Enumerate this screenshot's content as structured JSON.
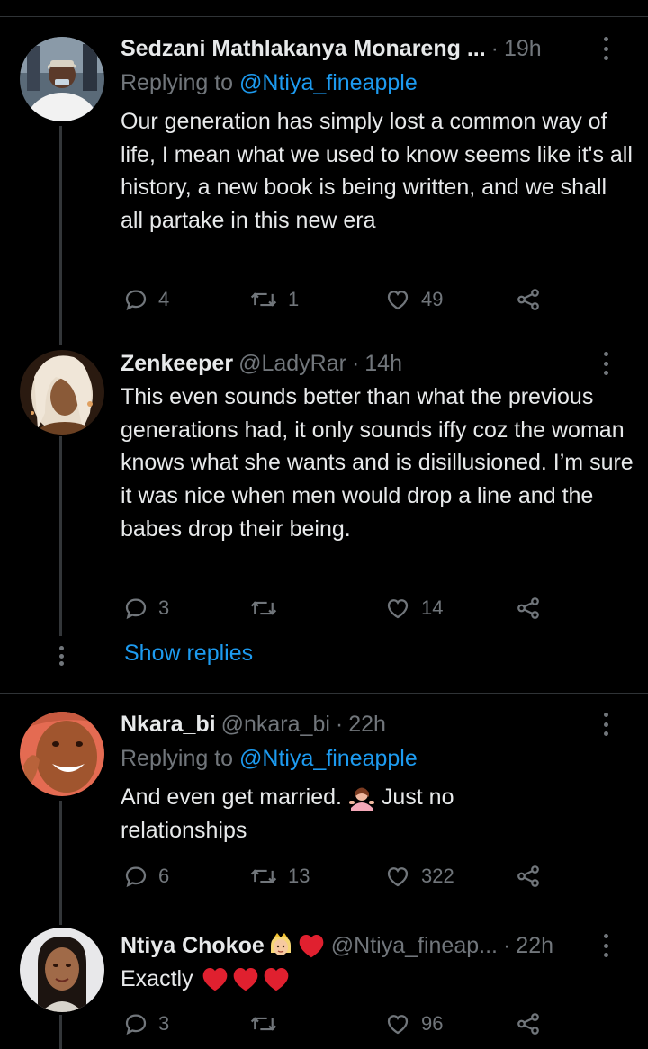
{
  "tweets": [
    {
      "name": "Sedzani Mathlakanya Monareng ...",
      "handle": "",
      "time": "19h",
      "reply_prefix": "Replying to",
      "reply_mention": "@Ntiya_fineapple",
      "text": "Our generation has simply lost a common way of life, I mean what we used to know seems like it's all history, a new book is being written, and we shall all partake in this new era",
      "replies": "4",
      "retweets": "1",
      "likes": "49"
    },
    {
      "name": "Zenkeeper",
      "handle": "@LadyRar",
      "time": "14h",
      "text": "This even sounds better than what the previous generations had, it only sounds iffy coz the woman knows what she wants and is disillusioned. I’m sure it was nice when men would drop a line and the babes drop their being.",
      "replies": "3",
      "retweets": "",
      "likes": "14"
    },
    {
      "name": "Nkara_bi",
      "handle": "@nkara_bi",
      "time": "22h",
      "reply_prefix": "Replying to",
      "reply_mention": "@Ntiya_fineapple",
      "text_a": "And even get married.",
      "text_b": "Just no",
      "text_c": "relationships",
      "replies": "6",
      "retweets": "13",
      "likes": "322"
    },
    {
      "name": "Ntiya Chokoe",
      "handle": "@Ntiya_fineap...",
      "time": "22h",
      "text": "Exactly",
      "replies": "3",
      "retweets": "",
      "likes": "96"
    }
  ],
  "show_replies": "Show replies",
  "colors": {
    "accent": "#1d9bf0",
    "muted": "#71767b",
    "heart": "#e0202f"
  },
  "icons": [
    "reply-icon",
    "retweet-icon",
    "like-icon",
    "share-icon",
    "more-icon",
    "heart-emoji",
    "woman-shrugging-emoji",
    "princess-emoji"
  ]
}
